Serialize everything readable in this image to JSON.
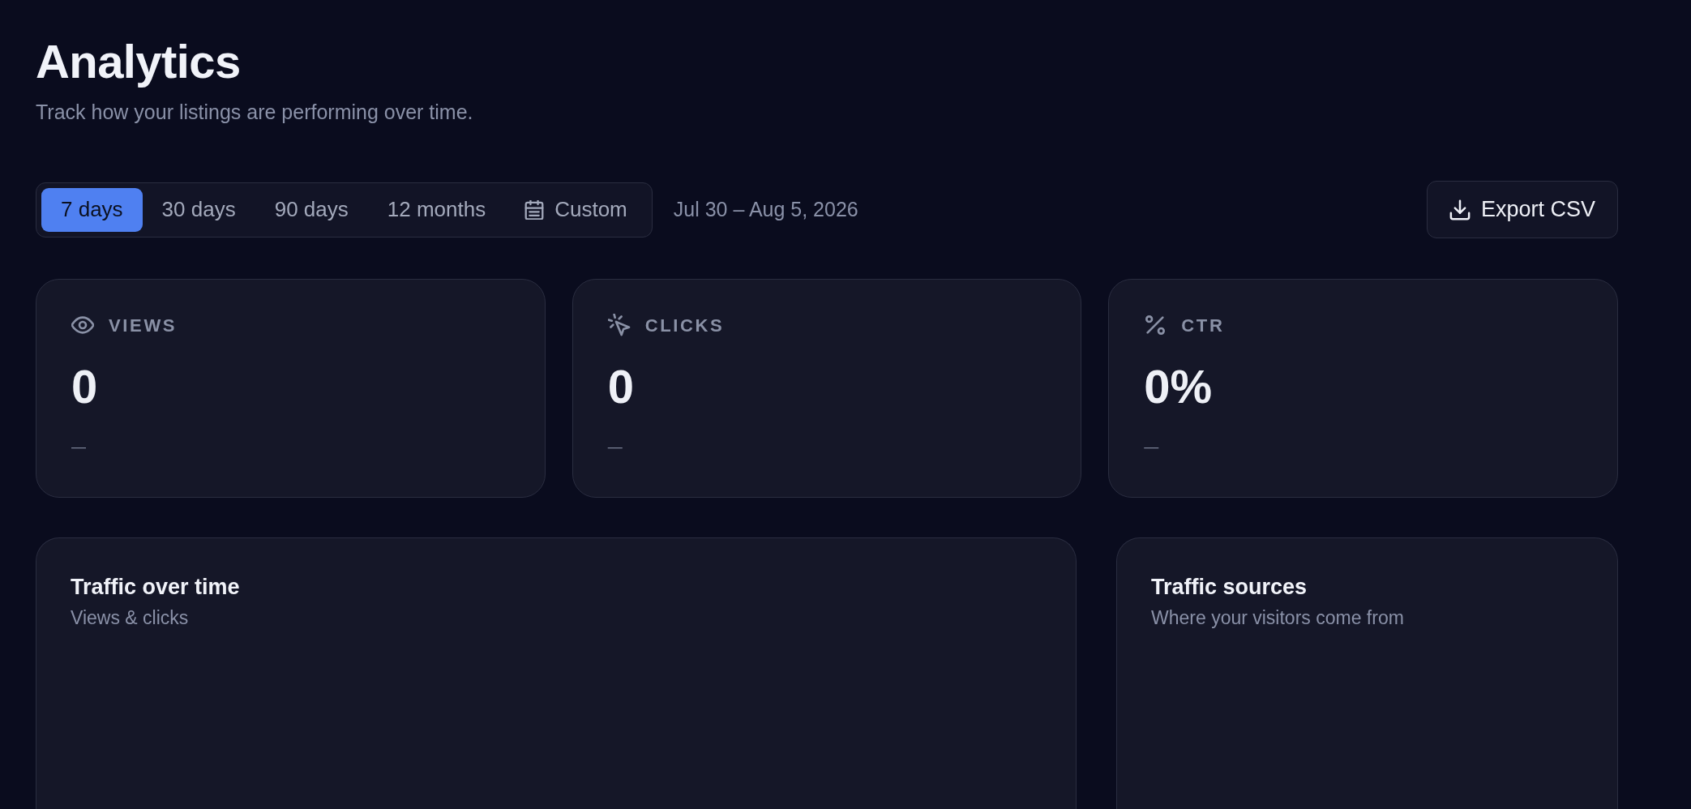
{
  "header": {
    "title": "Analytics",
    "subtitle": "Track how your listings are performing over time."
  },
  "range_tabs": [
    {
      "label": "7 days",
      "kind": "preset",
      "selected": true
    },
    {
      "label": "30 days",
      "kind": "preset",
      "selected": false
    },
    {
      "label": "90 days",
      "kind": "preset",
      "selected": false
    },
    {
      "label": "12 months",
      "kind": "preset",
      "selected": false
    },
    {
      "label": "Custom",
      "kind": "custom",
      "selected": false
    }
  ],
  "date_range": "Jul 30 – Aug 5, 2026",
  "export_button": {
    "label": "Export CSV"
  },
  "stats": [
    {
      "kind": "views",
      "label": "VIEWS",
      "value": "0",
      "change": "—"
    },
    {
      "kind": "clicks",
      "label": "CLICKS",
      "value": "0",
      "change": "—"
    },
    {
      "kind": "ctr",
      "label": "CTR",
      "value": "0%",
      "change": "—"
    }
  ],
  "panels": [
    {
      "title": "Traffic over time",
      "subtitle": "Views & clicks"
    },
    {
      "title": "Traffic sources",
      "subtitle": "Where your visitors come from"
    }
  ]
}
